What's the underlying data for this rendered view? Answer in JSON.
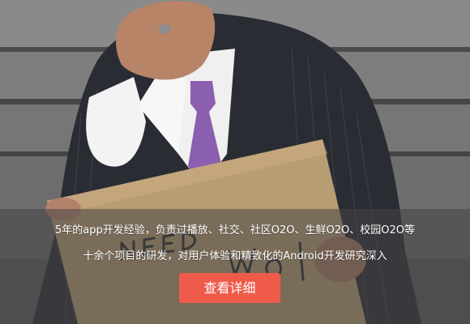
{
  "hero": {
    "image_alt": "Man in suit covering face holding a sign",
    "sign_text": "NEED WORK!",
    "caption_lines": [
      "5年的app开发经验，负责过播放、社交、社区O2O、生鲜O2O、校园O2O等",
      "十余个项目的研发，对用户体验和精致化的Android开发研究深入"
    ],
    "cta_label": "查看详细"
  },
  "colors": {
    "overlay": "rgba(70,70,70,0.55)",
    "cta": "#ef5b4b",
    "text": "#ffffff"
  }
}
